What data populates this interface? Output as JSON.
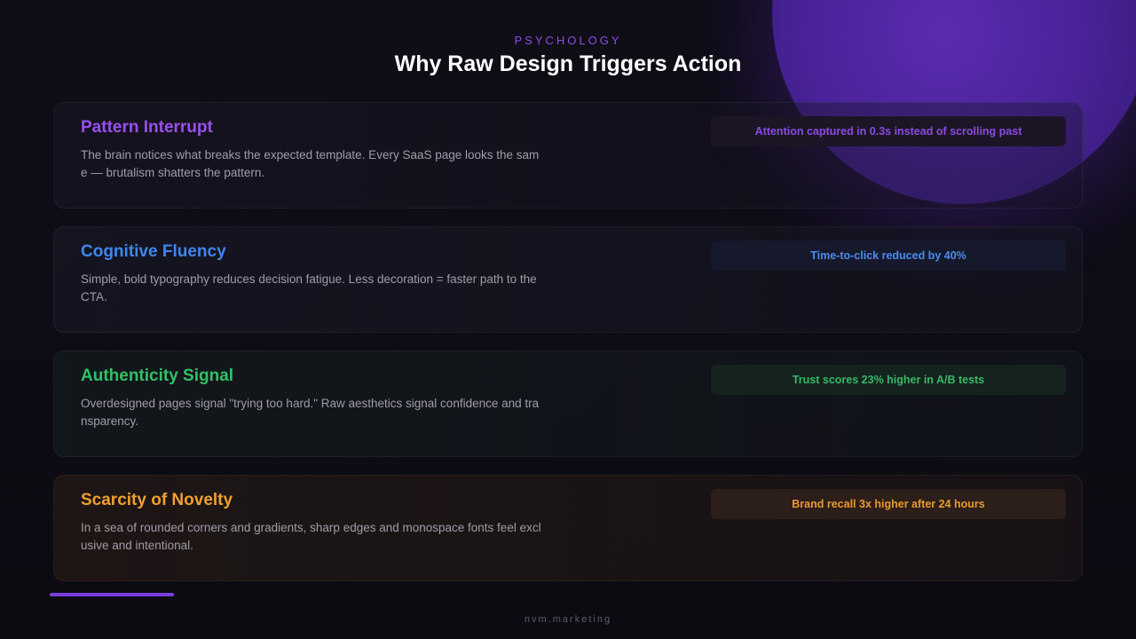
{
  "header": {
    "eyebrow": "PSYCHOLOGY",
    "title": "Why Raw Design Triggers Action"
  },
  "cards": [
    {
      "title": "Pattern Interrupt",
      "description": "The brain notices what breaks the expected template. Every SaaS page looks the same — brutalism shatters the pattern.",
      "stat": "Attention captured in 0.3s instead of scrolling past",
      "accent": "#9a4ff0",
      "badge_bg": "#1b1526",
      "badge_text": "#8a4ae0"
    },
    {
      "title": "Cognitive Fluency",
      "description": "Simple, bold typography reduces decision fatigue. Less decoration = faster path to the CTA.",
      "stat": "Time-to-click reduced by 40%",
      "accent": "#3f86f0",
      "badge_bg": "#16192b",
      "badge_text": "#4a8cf0"
    },
    {
      "title": "Authenticity Signal",
      "description": "Overdesigned pages signal \"trying too hard.\" Raw aesthetics signal confidence and transparency.",
      "stat": "Trust scores 23% higher in A/B tests",
      "accent": "#33c066",
      "badge_bg": "#15231f",
      "badge_text": "#36b863"
    },
    {
      "title": "Scarcity of Novelty",
      "description": "In a sea of rounded corners and gradients, sharp edges and monospace fonts feel exclusive and intentional.",
      "stat": "Brand recall 3x higher after 24 hours",
      "accent": "#f0a030",
      "badge_bg": "#2c1e18",
      "badge_text": "#e89a30"
    }
  ],
  "footer": {
    "text": "nvm.marketing"
  }
}
